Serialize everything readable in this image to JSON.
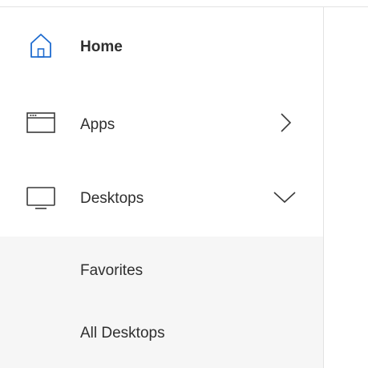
{
  "nav": {
    "home": {
      "label": "Home",
      "icon": "home-icon",
      "active_color": "#1f6ccf"
    },
    "apps": {
      "label": "Apps",
      "icon": "apps-window-icon",
      "chevron": "chevron-right-icon"
    },
    "desktops": {
      "label": "Desktops",
      "icon": "monitor-icon",
      "chevron": "chevron-down-icon"
    }
  },
  "desktops_submenu": {
    "items": [
      {
        "label": "Favorites"
      },
      {
        "label": "All Desktops"
      }
    ]
  },
  "colors": {
    "text": "#2f2f2f",
    "icon": "#3a3a3a",
    "submenu_bg": "#f6f6f6",
    "divider": "#e3e3e3"
  }
}
